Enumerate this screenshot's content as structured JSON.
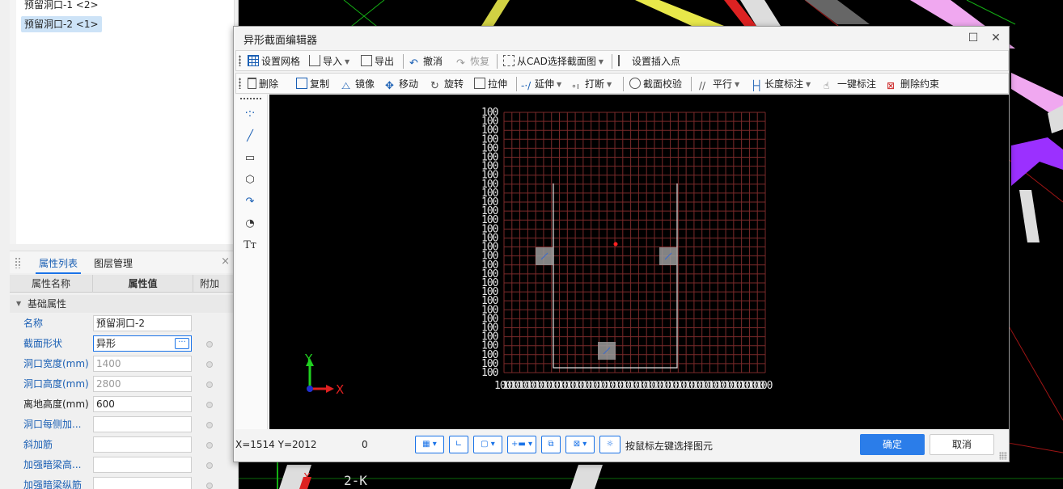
{
  "tree": {
    "items": [
      {
        "label": "预留洞口-1 <2>",
        "selected": false
      },
      {
        "label": "预留洞口-2 <1>",
        "selected": true
      }
    ]
  },
  "props": {
    "tabs": [
      "属性列表",
      "图层管理"
    ],
    "close": "×",
    "headers": {
      "name": "属性名称",
      "value": "属性值",
      "extra": "附加"
    },
    "group": "基础属性",
    "rows": [
      {
        "name": "名称",
        "value": "预留洞口-2",
        "blue": true,
        "grey": false,
        "dot": false
      },
      {
        "name": "截面形状",
        "value": "异形",
        "blue": true,
        "grey": false,
        "dot": true,
        "more": "···"
      },
      {
        "name": "洞口宽度(mm)",
        "value": "1400",
        "blue": true,
        "grey": true,
        "dot": true
      },
      {
        "name": "洞口高度(mm)",
        "value": "2800",
        "blue": true,
        "grey": true,
        "dot": true
      },
      {
        "name": "离地高度(mm)",
        "value": "600",
        "blue": false,
        "grey": false,
        "dot": true
      },
      {
        "name": "洞口每侧加...",
        "value": "",
        "blue": true,
        "grey": false,
        "dot": true
      },
      {
        "name": "斜加筋",
        "value": "",
        "blue": true,
        "grey": false,
        "dot": true
      },
      {
        "name": "加强暗梁高...",
        "value": "",
        "blue": true,
        "grey": false,
        "dot": true
      },
      {
        "name": "加强暗梁纵筋",
        "value": "",
        "blue": true,
        "grey": false,
        "dot": true
      }
    ]
  },
  "dialog": {
    "title": "异形截面编辑器",
    "toolbar1": [
      "设置网格",
      "导入",
      "导出",
      "撤消",
      "恢复",
      "从CAD选择截面图",
      "设置插入点"
    ],
    "toolbar2": [
      "删除",
      "复制",
      "镜像",
      "移动",
      "旋转",
      "拉伸",
      "延伸",
      "打断",
      "截面校验",
      "平行",
      "长度标注",
      "一键标注",
      "删除约束"
    ],
    "vtools": [
      "·:·",
      "╱",
      "▭",
      "⬡",
      "↷",
      "◔",
      "Tт"
    ],
    "grid_label": "100",
    "axis_y": "Y",
    "axis_x": "X",
    "status": {
      "coord": "X=1514 Y=2012",
      "z": "0",
      "hint": "按鼠标左键选择图元",
      "ok": "确定",
      "cancel": "取消"
    }
  },
  "background": {
    "label": "2-K"
  },
  "colors": {
    "accent": "#1a73e8",
    "grid": "#7a2a2a",
    "outline": "#e0e0e0",
    "cad_yellow": "#e8e84a",
    "cad_purple": "#9b30ff",
    "cad_pink": "#f0a8f0"
  }
}
